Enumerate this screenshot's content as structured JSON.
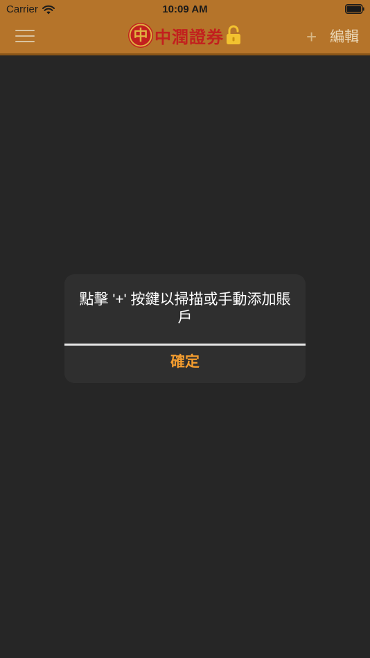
{
  "status_bar": {
    "carrier": "Carrier",
    "time": "10:09 AM",
    "wifi_icon": "wifi-icon",
    "battery_icon": "battery-icon"
  },
  "header": {
    "menu_icon": "hamburger-menu-icon",
    "logo_emblem": "中",
    "logo_text": "中潤證券",
    "lock_icon": "lock-icon",
    "add_label": "+",
    "edit_label": "編輯",
    "background_color": "#b5742a",
    "logo_text_color": "#c2201e"
  },
  "alert": {
    "message": "點擊 '+' 按鍵以掃描或手動添加賬戶",
    "confirm_label": "確定",
    "confirm_color": "#f39c2f"
  },
  "colors": {
    "page_background": "#262626",
    "alert_background": "#2f2f2f"
  }
}
